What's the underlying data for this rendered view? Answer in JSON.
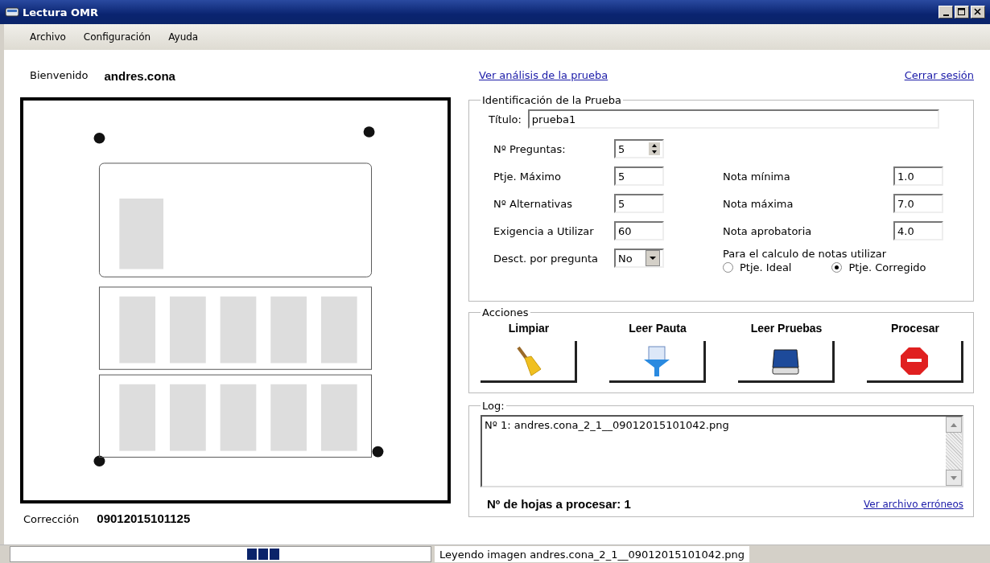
{
  "window": {
    "title": "Lectura OMR"
  },
  "menu": [
    {
      "label": "Archivo"
    },
    {
      "label": "Configuración"
    },
    {
      "label": "Ayuda"
    }
  ],
  "welcome": {
    "label": "Bienvenido",
    "user": "andres.cona"
  },
  "links": {
    "analysis": "Ver análisis de la prueba",
    "logout": "Cerrar sesión"
  },
  "correction": {
    "label": "Corrección",
    "value": "09012015101125"
  },
  "identification": {
    "legend": "Identificación de la Prueba",
    "title_label": "Título:",
    "title_value": "prueba1",
    "left_fields": [
      {
        "label": "Nº Preguntas:",
        "value": "5",
        "kind": "spinner"
      },
      {
        "label": "Ptje. Máximo",
        "value": "5",
        "kind": "text"
      },
      {
        "label": "Nº Alternativas",
        "value": "5",
        "kind": "text"
      },
      {
        "label": "Exigencia a Utilizar",
        "value": "60",
        "kind": "text"
      },
      {
        "label": "Desct. por pregunta",
        "value": "No",
        "kind": "dropdown"
      }
    ],
    "right_fields": [
      {
        "label": "Nota mínima",
        "value": "1.0"
      },
      {
        "label": "Nota máxima",
        "value": "7.0"
      },
      {
        "label": "Nota aprobatoria",
        "value": "4.0"
      }
    ],
    "calc_label": "Para el calculo de notas utilizar",
    "calc_options": [
      {
        "label": "Ptje. Ideal",
        "selected": false
      },
      {
        "label": "Ptje. Corregido",
        "selected": true
      }
    ]
  },
  "actions": {
    "legend": "Acciones",
    "buttons": [
      {
        "label": "Limpiar",
        "kind": "broom"
      },
      {
        "label": "Leer Pauta",
        "kind": "funnel"
      },
      {
        "label": "Leer Pruebas",
        "kind": "scanner"
      },
      {
        "label": "Procesar",
        "kind": "stop"
      }
    ]
  },
  "log": {
    "legend": "Log:",
    "lines": [
      "Nº 1: andres.cona_2_1__09012015101042.png"
    ],
    "count": "Nº de hojas a procesar: 1",
    "errors_link": "Ver archivo erróneos"
  },
  "status_bar": {
    "progress": {
      "level": 0.64
    },
    "message": "Leyendo imagen andres.cona_2_1__09012015101042.png"
  }
}
